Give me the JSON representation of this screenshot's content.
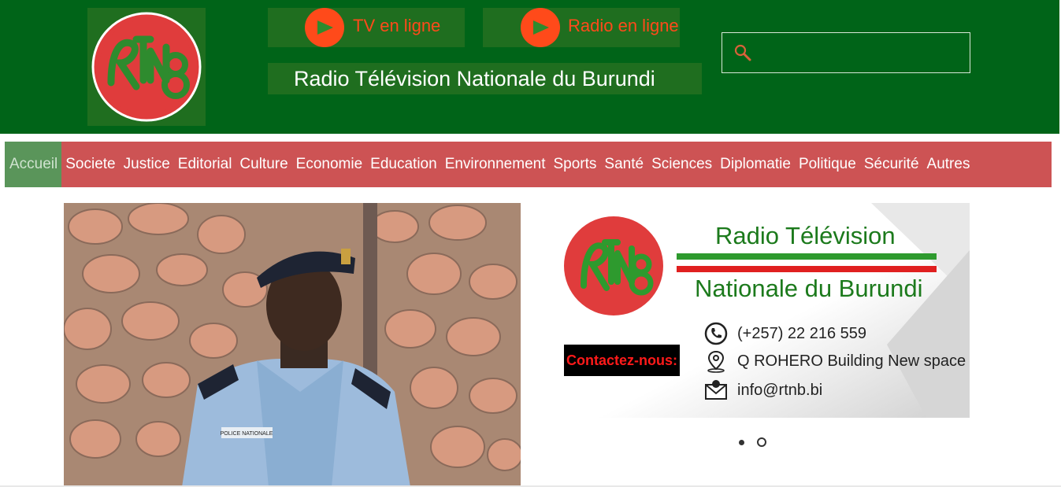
{
  "header": {
    "logo_text": "RTNB",
    "tv_label": "TV en ligne",
    "radio_label": "Radio en ligne",
    "site_title": "Radio Télévision Nationale du Burundi",
    "search_placeholder": "",
    "colors": {
      "header_bg": "#006418",
      "accent": "#ff4a1a"
    }
  },
  "nav": {
    "items": [
      {
        "label": "Accueil",
        "active": true
      },
      {
        "label": "Societe"
      },
      {
        "label": "Justice"
      },
      {
        "label": "Editorial"
      },
      {
        "label": "Culture"
      },
      {
        "label": "Economie"
      },
      {
        "label": "Education"
      },
      {
        "label": "Environnement"
      },
      {
        "label": "Sports"
      },
      {
        "label": "Santé"
      },
      {
        "label": "Sciences"
      },
      {
        "label": "Diplomatie"
      },
      {
        "label": "Politique"
      },
      {
        "label": "Sécurité"
      },
      {
        "label": "Autres"
      }
    ],
    "colors": {
      "bg": "#cd5354",
      "active_bg": "#5a955a"
    }
  },
  "hero": {
    "badge_text": "POLICE NATIONALE"
  },
  "banner": {
    "title_line1": "Radio Télévision",
    "title_line2": "Nationale du Burundi",
    "contact_label": "Contactez-nous:",
    "phone": "(+257)  22 216 559",
    "address": "Q ROHERO  Building New space",
    "email": "info@rtnb.bi"
  },
  "slider": {
    "slides": 2,
    "active": 1
  }
}
